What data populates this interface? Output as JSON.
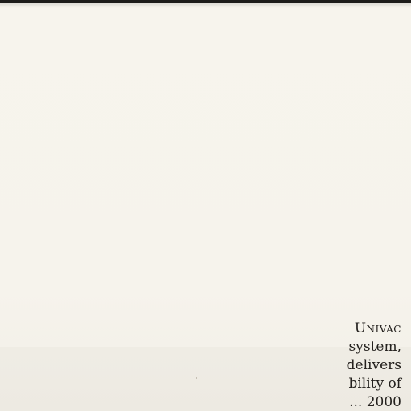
{
  "document": {
    "lines": [
      "Univac",
      "system,",
      "delivers",
      "bility of",
      "... 2000"
    ]
  }
}
